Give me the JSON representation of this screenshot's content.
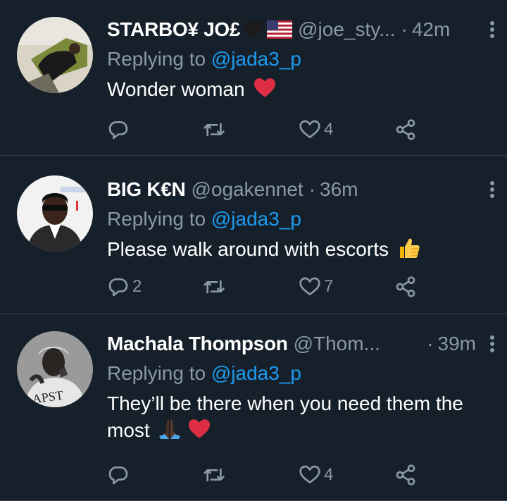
{
  "tweets": [
    {
      "name": "STARBO¥ JO£",
      "handle": "@joe_sty...",
      "dot": "·",
      "time": "42m",
      "replying_prefix": "Replying to ",
      "replying_to": "@jada3_p",
      "text": "Wonder woman",
      "reply_count": "",
      "retweet_count": "",
      "like_count": "4",
      "name_emojis": [
        "black-heart-icon",
        "us-flag-icon"
      ],
      "text_emojis": [
        "red-heart-icon"
      ]
    },
    {
      "name": "BIG K€N",
      "handle": "@ogakennet",
      "dot": "·",
      "time": "36m",
      "replying_prefix": "Replying to ",
      "replying_to": "@jada3_p",
      "text": "Please walk around with escorts",
      "reply_count": "2",
      "retweet_count": "",
      "like_count": "7",
      "name_emojis": [],
      "text_emojis": [
        "thumbs-up-icon"
      ]
    },
    {
      "name": "Machala Thompson",
      "handle": "@Thom...",
      "dot": "·",
      "time": "39m",
      "replying_prefix": "Replying to ",
      "replying_to": "@jada3_p",
      "text": "They’ll be there when you need them the most",
      "reply_count": "",
      "retweet_count": "",
      "like_count": "4",
      "name_emojis": [],
      "text_emojis": [
        "folded-hands-icon",
        "red-heart-icon"
      ]
    }
  ],
  "colors": {
    "background": "#15202b",
    "divider": "#38444d",
    "secondary_text": "#8b98a5",
    "link": "#1d9bf0",
    "primary_text": "#ffffff"
  }
}
